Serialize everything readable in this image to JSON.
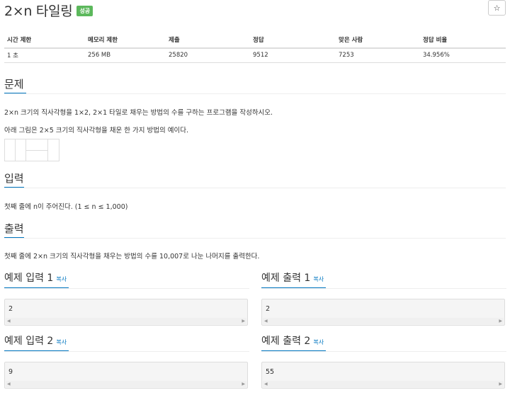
{
  "title": "2×n 타일링",
  "badge": "성공",
  "star": "☆",
  "info": {
    "headers": [
      "시간 제한",
      "메모리 제한",
      "제출",
      "정답",
      "맞은 사람",
      "정답 비율"
    ],
    "values": [
      "1 초",
      "256 MB",
      "25820",
      "9512",
      "7253",
      "34.956%"
    ]
  },
  "problem": {
    "heading": "문제",
    "text1": "2×n 크기의 직사각형을 1×2, 2×1 타일로 채우는 방법의 수를 구하는 프로그램을 작성하시오.",
    "text2": "아래 그림은 2×5 크기의 직사각형을 채운 한 가지 방법의 예이다."
  },
  "input": {
    "heading": "입력",
    "text": "첫째 줄에 n이 주어진다. (1 ≤ n ≤ 1,000)"
  },
  "output": {
    "heading": "출력",
    "text": "첫째 줄에 2×n 크기의 직사각형을 채우는 방법의 수를 10,007로 나눈 나머지를 출력한다."
  },
  "examples": [
    {
      "title": "예제 입력 1",
      "copy": "복사",
      "value": "2"
    },
    {
      "title": "예제 출력 1",
      "copy": "복사",
      "value": "2"
    },
    {
      "title": "예제 입력 2",
      "copy": "복사",
      "value": "9"
    },
    {
      "title": "예제 출력 2",
      "copy": "복사",
      "value": "55"
    }
  ]
}
